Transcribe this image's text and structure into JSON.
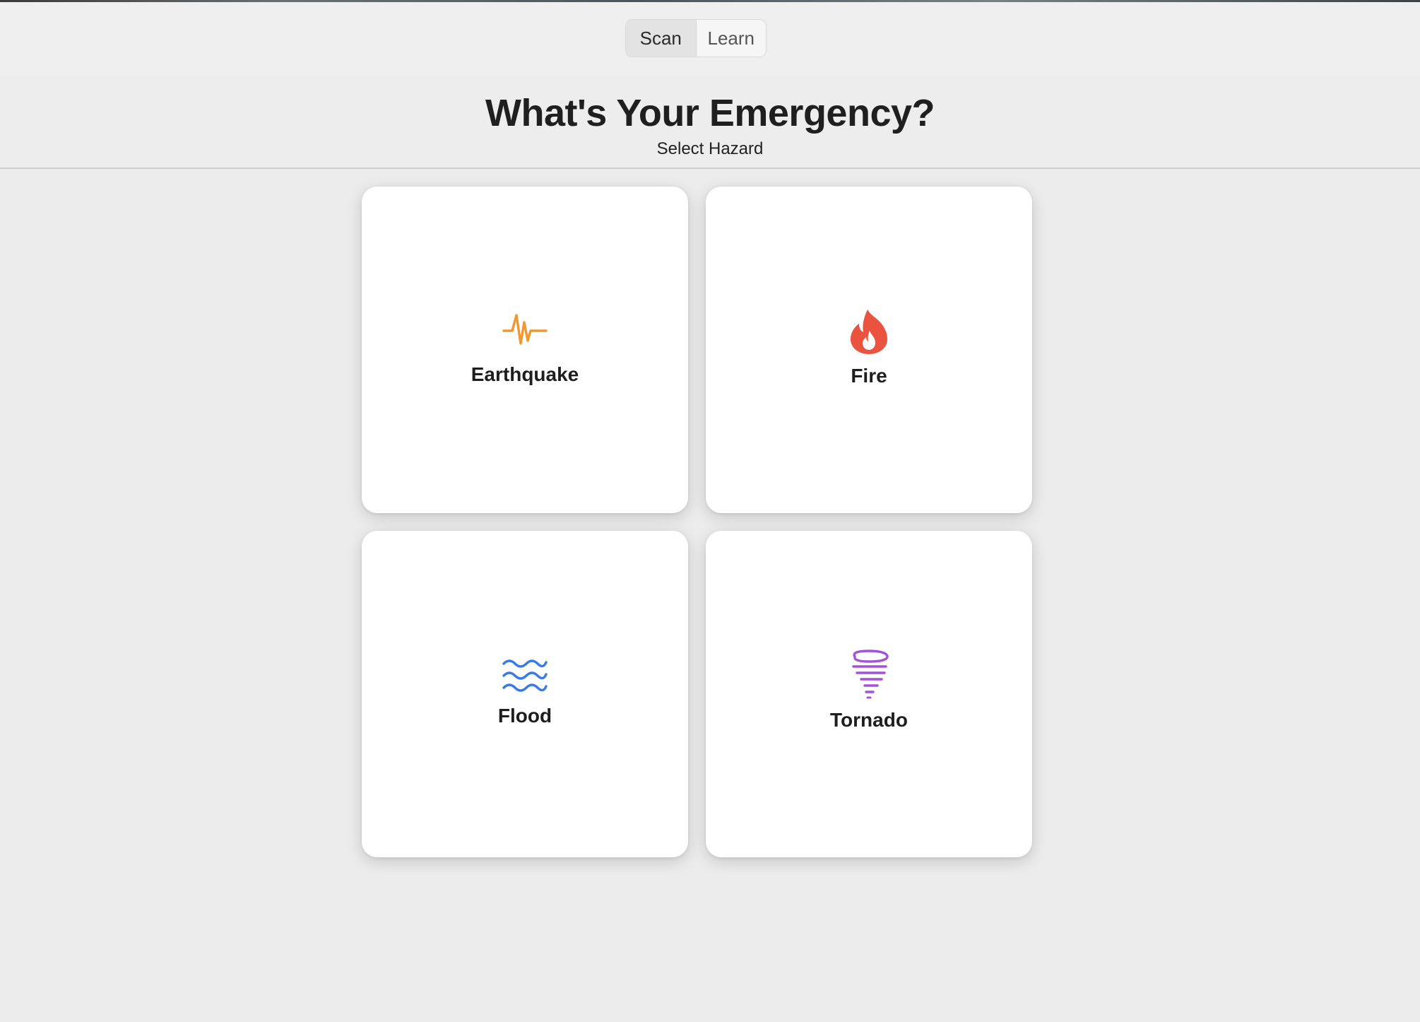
{
  "toolbar": {
    "tabs": [
      {
        "label": "Scan",
        "selected": true
      },
      {
        "label": "Learn",
        "selected": false
      }
    ]
  },
  "header": {
    "title": "What's Your Emergency?",
    "subtitle": "Select Hazard"
  },
  "hazards": [
    {
      "label": "Earthquake",
      "icon": "waveform-path-icon",
      "color": "#f0982f"
    },
    {
      "label": "Fire",
      "icon": "flame-icon",
      "color": "#e9533f"
    },
    {
      "label": "Flood",
      "icon": "water-waves-icon",
      "color": "#3a79ea"
    },
    {
      "label": "Tornado",
      "icon": "tornado-icon",
      "color": "#a452d8"
    }
  ]
}
